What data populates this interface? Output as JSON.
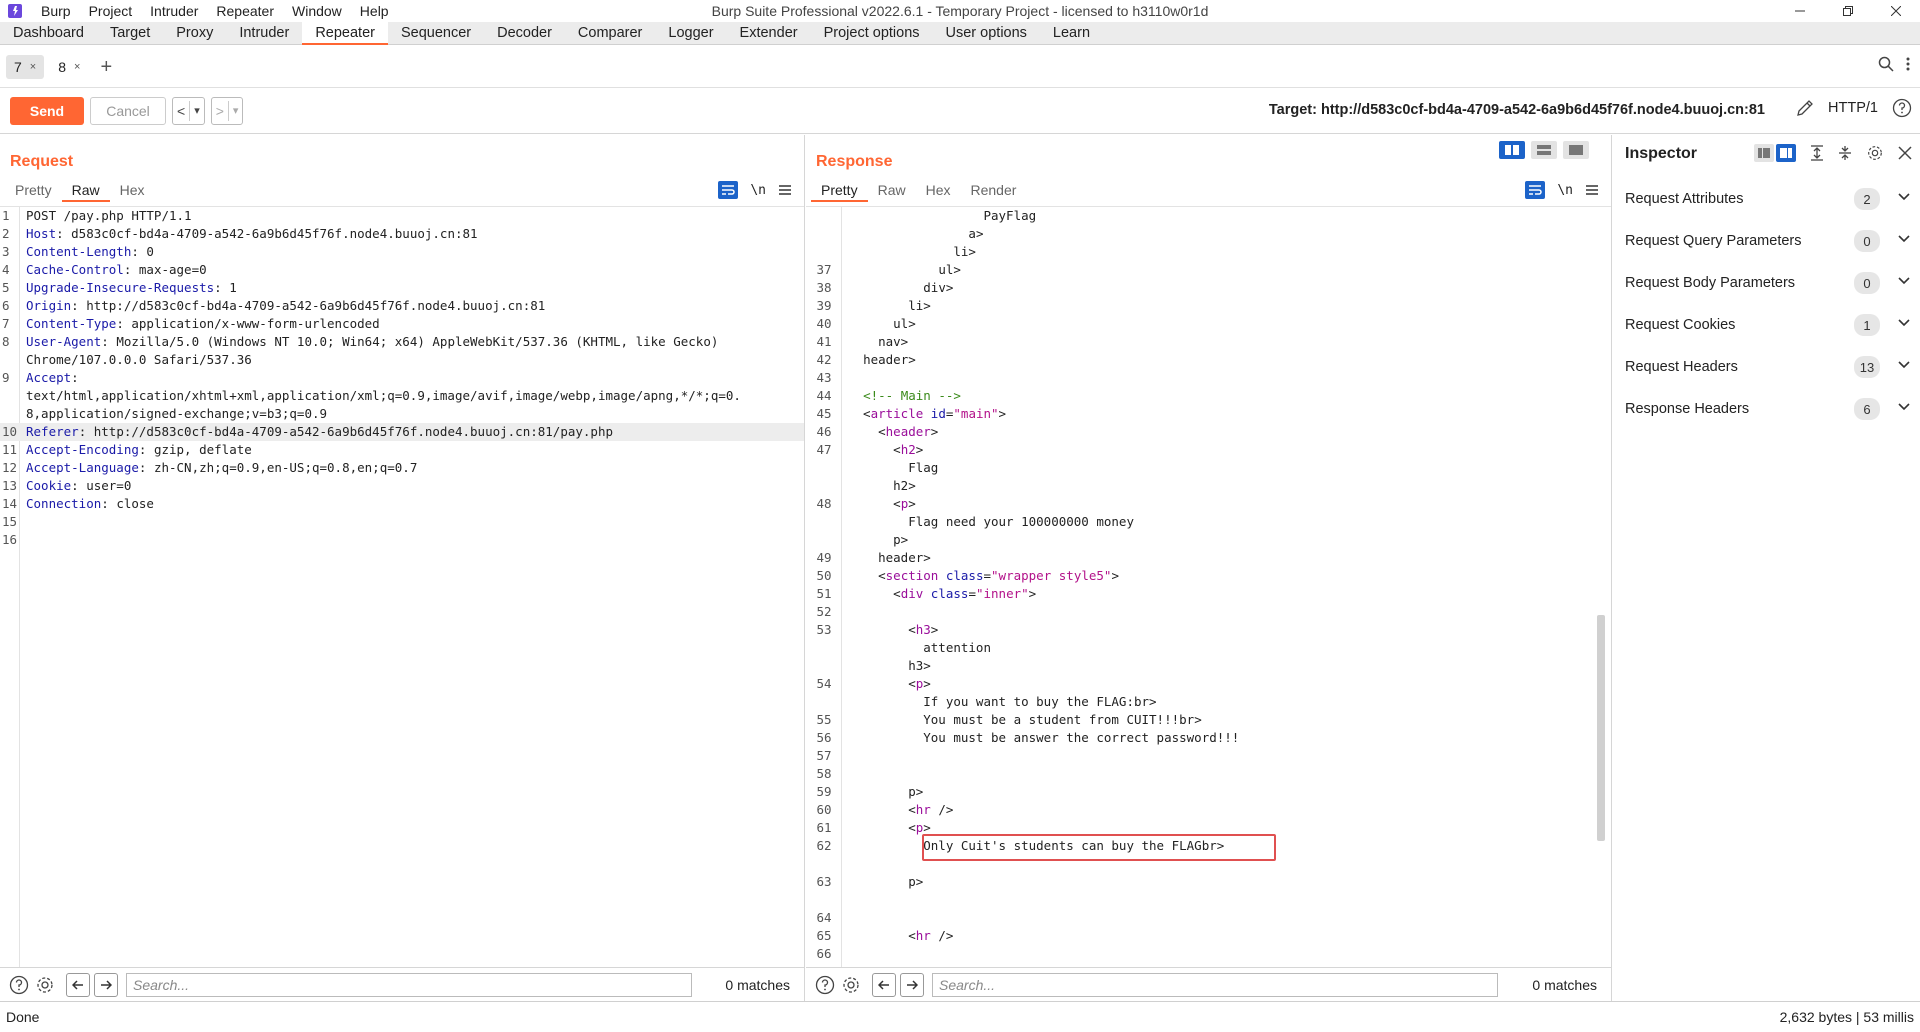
{
  "window": {
    "title": "Burp Suite Professional v2022.6.1 - Temporary Project - licensed to h3110w0r1d",
    "menu": [
      "Burp",
      "Project",
      "Intruder",
      "Repeater",
      "Window",
      "Help"
    ]
  },
  "main_tabs": [
    "Dashboard",
    "Target",
    "Proxy",
    "Intruder",
    "Repeater",
    "Sequencer",
    "Decoder",
    "Comparer",
    "Logger",
    "Extender",
    "Project options",
    "User options",
    "Learn"
  ],
  "active_main_tab": "Repeater",
  "repeater_tabs": [
    {
      "label": "7",
      "close": "×"
    },
    {
      "label": "8",
      "close": "×"
    }
  ],
  "add_tab": "+",
  "toolbar": {
    "send": "Send",
    "cancel": "Cancel",
    "back": "<",
    "forward": ">",
    "dropdown": "▾",
    "target": "Target: http://d583c0cf-bd4a-4709-a542-6a9b6d45f76f.node4.buuoj.cn:81",
    "protocol": "HTTP/1"
  },
  "request": {
    "title": "Request",
    "tabs": [
      "Pretty",
      "Raw",
      "Hex"
    ],
    "active_tab": "Raw",
    "newline_toggle": "\\n",
    "lines": [
      {
        "n": "1",
        "key": "",
        "val": "POST /pay.php HTTP/1.1"
      },
      {
        "n": "2",
        "key": "Host",
        "val": ": d583c0cf-bd4a-4709-a542-6a9b6d45f76f.node4.buuoj.cn:81"
      },
      {
        "n": "3",
        "key": "Content-Length",
        "val": ": 0"
      },
      {
        "n": "4",
        "key": "Cache-Control",
        "val": ": max-age=0"
      },
      {
        "n": "5",
        "key": "Upgrade-Insecure-Requests",
        "val": ": 1"
      },
      {
        "n": "6",
        "key": "Origin",
        "val": ": http://d583c0cf-bd4a-4709-a542-6a9b6d45f76f.node4.buuoj.cn:81"
      },
      {
        "n": "7",
        "key": "Content-Type",
        "val": ": application/x-www-form-urlencoded"
      },
      {
        "n": "8",
        "key": "User-Agent",
        "val": ": Mozilla/5.0 (Windows NT 10.0; Win64; x64) AppleWebKit/537.36 (KHTML, like Gecko)\nChrome/107.0.0.0 Safari/537.36"
      },
      {
        "n": "9",
        "key": "Accept",
        "val": ":\ntext/html,application/xhtml+xml,application/xml;q=0.9,image/avif,image/webp,image/apng,*/*;q=0.\n8,application/signed-exchange;v=b3;q=0.9"
      },
      {
        "n": "10",
        "key": "Referer",
        "val": ": http://d583c0cf-bd4a-4709-a542-6a9b6d45f76f.node4.buuoj.cn:81/pay.php"
      },
      {
        "n": "11",
        "key": "Accept-Encoding",
        "val": ": gzip, deflate"
      },
      {
        "n": "12",
        "key": "Accept-Language",
        "val": ": zh-CN,zh;q=0.9,en-US;q=0.8,en;q=0.7"
      },
      {
        "n": "13",
        "key": "Cookie",
        "val": ": user=0"
      },
      {
        "n": "14",
        "key": "Connection",
        "val": ": close"
      },
      {
        "n": "15",
        "key": "",
        "val": ""
      },
      {
        "n": "16",
        "key": "",
        "val": ""
      }
    ],
    "search_placeholder": "Search...",
    "matches": "0 matches"
  },
  "response": {
    "title": "Response",
    "tabs": [
      "Pretty",
      "Raw",
      "Hex",
      "Render"
    ],
    "active_tab": "Pretty",
    "newline_toggle": "\\n",
    "lines": [
      {
        "n": "",
        "html": "                  PayFlag"
      },
      {
        "n": "",
        "html": "                </<span class=\"tg\">a</span>>"
      },
      {
        "n": "",
        "html": "              </<span class=\"tg\">li</span>>"
      },
      {
        "n": "37",
        "html": "            </<span class=\"tg\">ul</span>>"
      },
      {
        "n": "38",
        "html": "          </<span class=\"tg\">div</span>>"
      },
      {
        "n": "39",
        "html": "        </<span class=\"tg\">li</span>>"
      },
      {
        "n": "40",
        "html": "      </<span class=\"tg\">ul</span>>"
      },
      {
        "n": "41",
        "html": "    </<span class=\"tg\">nav</span>>"
      },
      {
        "n": "42",
        "html": "  </<span class=\"tg\">header</span>>"
      },
      {
        "n": "43",
        "html": ""
      },
      {
        "n": "44",
        "html": "  <span class=\"cm\">&lt;!-- Main --&gt;</span>"
      },
      {
        "n": "45",
        "html": "  <<span class=\"tg\">article</span> <span class=\"at\">id</span>=<span class=\"av\">\"main\"</span>>"
      },
      {
        "n": "46",
        "html": "    <<span class=\"tg\">header</span>>"
      },
      {
        "n": "47",
        "html": "      <<span class=\"tg\">h2</span>>"
      },
      {
        "n": "",
        "html": "        Flag"
      },
      {
        "n": "",
        "html": "      </<span class=\"tg\">h2</span>>"
      },
      {
        "n": "48",
        "html": "      <<span class=\"tg\">p</span>>"
      },
      {
        "n": "",
        "html": "        Flag need your 100000000 money"
      },
      {
        "n": "",
        "html": "      </<span class=\"tg\">p</span>>"
      },
      {
        "n": "49",
        "html": "    </<span class=\"tg\">header</span>>"
      },
      {
        "n": "50",
        "html": "    <<span class=\"tg\">section</span> <span class=\"at\">class</span>=<span class=\"av\">\"wrapper style5\"</span>>"
      },
      {
        "n": "51",
        "html": "      <<span class=\"tg\">div</span> <span class=\"at\">class</span>=<span class=\"av\">\"inner\"</span>>"
      },
      {
        "n": "52",
        "html": ""
      },
      {
        "n": "53",
        "html": "        <<span class=\"tg\">h3</span>>"
      },
      {
        "n": "",
        "html": "          attention"
      },
      {
        "n": "",
        "html": "        </<span class=\"tg\">h3</span>>"
      },
      {
        "n": "54",
        "html": "        <<span class=\"tg\">p</span>>"
      },
      {
        "n": "",
        "html": "          If you want to buy the FLAG:</<span class=\"tg\">br</span>>"
      },
      {
        "n": "55",
        "html": "          You must be a student from CUIT!!!</<span class=\"tg\">br</span>>"
      },
      {
        "n": "56",
        "html": "          You must be answer the correct password!!!"
      },
      {
        "n": "57",
        "html": ""
      },
      {
        "n": "58",
        "html": ""
      },
      {
        "n": "59",
        "html": "        </<span class=\"tg\">p</span>>"
      },
      {
        "n": "60",
        "html": "        <<span class=\"tg\">hr</span> />"
      },
      {
        "n": "61",
        "html": "        <<span class=\"tg\">p</span>>"
      },
      {
        "n": "62",
        "html": "          Only Cuit's students can buy the FLAG</<span class=\"tg\">br</span>>"
      },
      {
        "n": "",
        "html": ""
      },
      {
        "n": "63",
        "html": "        </<span class=\"tg\">p</span>>"
      },
      {
        "n": "",
        "html": ""
      },
      {
        "n": "64",
        "html": ""
      },
      {
        "n": "65",
        "html": "        <<span class=\"tg\">hr</span> />"
      },
      {
        "n": "66",
        "html": ""
      }
    ],
    "search_placeholder": "Search...",
    "matches": "0 matches"
  },
  "inspector": {
    "title": "Inspector",
    "sections": [
      {
        "label": "Request Attributes",
        "count": "2"
      },
      {
        "label": "Request Query Parameters",
        "count": "0"
      },
      {
        "label": "Request Body Parameters",
        "count": "0"
      },
      {
        "label": "Request Cookies",
        "count": "1"
      },
      {
        "label": "Request Headers",
        "count": "13"
      },
      {
        "label": "Response Headers",
        "count": "6"
      }
    ]
  },
  "status": {
    "left": "Done",
    "right": "2,632 bytes | 53 millis"
  },
  "colors": {
    "accent": "#ff6633",
    "header_key": "#1a1aa8",
    "tag": "#9a0e9a",
    "attr_value": "#b3128a",
    "comment": "#3a8a1a",
    "highlight_box": "#e05050"
  }
}
